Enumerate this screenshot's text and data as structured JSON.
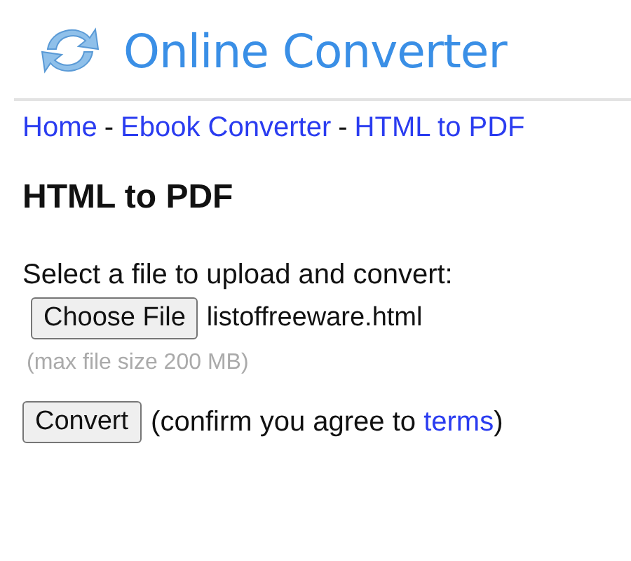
{
  "site_title": "Online Converter",
  "breadcrumb": {
    "separator": "-",
    "items": [
      "Home",
      "Ebook Converter",
      "HTML to PDF"
    ]
  },
  "heading": "HTML to PDF",
  "upload": {
    "label": "Select a file to upload and convert:",
    "button": "Choose File",
    "file_name": "listoffreeware.html",
    "hint": "(max file size 200 MB)"
  },
  "convert": {
    "button": "Convert",
    "note_before": "(confirm you agree to ",
    "link": "terms",
    "note_after": ")"
  }
}
